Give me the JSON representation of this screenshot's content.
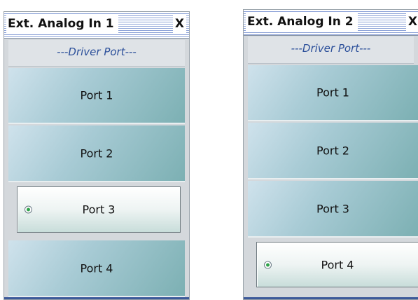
{
  "menus": [
    {
      "title": "Ext. Analog In 1",
      "close": "X",
      "section_label": "---Driver Port---",
      "items": [
        {
          "label": "Port 1",
          "selected": false
        },
        {
          "label": "Port 2",
          "selected": false
        },
        {
          "label": "Port 3",
          "selected": true
        },
        {
          "label": "Port 4",
          "selected": false
        }
      ]
    },
    {
      "title": "Ext. Analog In 2",
      "close": "X",
      "section_label": "---Driver Port---",
      "items": [
        {
          "label": "Port 1",
          "selected": false
        },
        {
          "label": "Port 2",
          "selected": false
        },
        {
          "label": "Port 3",
          "selected": false
        },
        {
          "label": "Port 4",
          "selected": true
        }
      ]
    }
  ],
  "colors": {
    "section_label_text": "#2b4f9a",
    "radio_selected": "#2fa34a",
    "button_gradient_start": "#cfe2ec",
    "button_gradient_end": "#7cb0b3"
  },
  "icons": {
    "selected_item_indicator": "radio-selected-icon"
  }
}
